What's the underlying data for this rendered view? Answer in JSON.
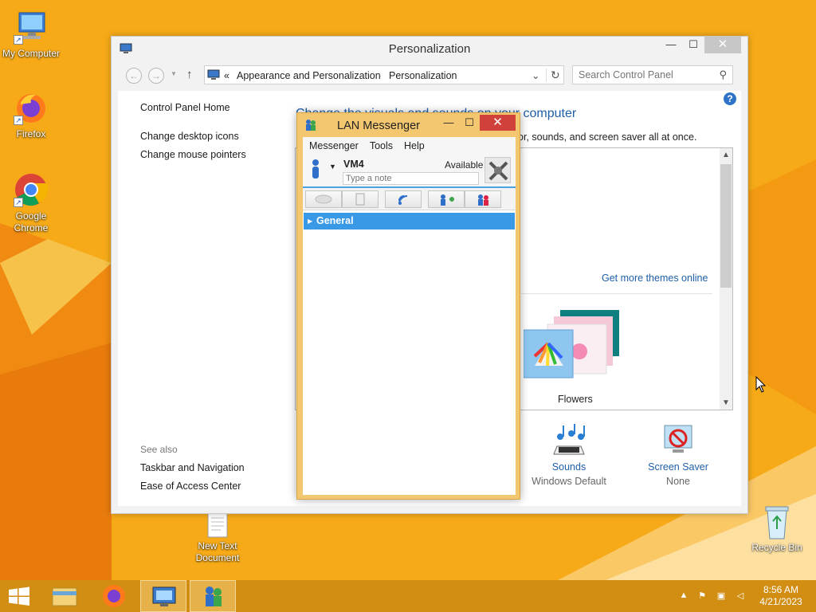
{
  "desktop": {
    "icons": [
      {
        "label": "My Computer"
      },
      {
        "label": "Firefox"
      },
      {
        "label": "Google Chrome"
      },
      {
        "label": "New Text Document"
      },
      {
        "label": "Recycle Bin"
      }
    ]
  },
  "personalization": {
    "title": "Personalization",
    "address": {
      "prefix": "«",
      "crumb1": "Appearance and Personalization",
      "crumb2": "Personalization"
    },
    "search_placeholder": "Search Control Panel",
    "sidebar": {
      "home": "Control Panel Home",
      "links": [
        "Change desktop icons",
        "Change mouse pointers"
      ],
      "see_also": "See also",
      "see_also_links": [
        "Taskbar and Navigation",
        "Ease of Access Center"
      ]
    },
    "heading": "Change the visuals and sounds on your computer",
    "subheading": "or, sounds, and screen saver all at once.",
    "get_more_themes": "Get more themes online",
    "theme_name": "Flowers",
    "bottom": {
      "sounds_label": "Sounds",
      "sounds_value": "Windows Default",
      "screensaver_label": "Screen Saver",
      "screensaver_value": "None"
    }
  },
  "lan": {
    "title": "LAN Messenger",
    "menu": [
      "Messenger",
      "Tools",
      "Help"
    ],
    "user_name": "VM4",
    "status": "Available",
    "note_placeholder": "Type a note",
    "group": "General"
  },
  "taskbar": {
    "time": "8:56 AM",
    "date": "4/21/2023"
  },
  "colors": {
    "accent_blue": "#1e5fa9",
    "lan_frame": "#f3c770",
    "group_blue": "#3999e6",
    "close_red": "#d0413b"
  }
}
